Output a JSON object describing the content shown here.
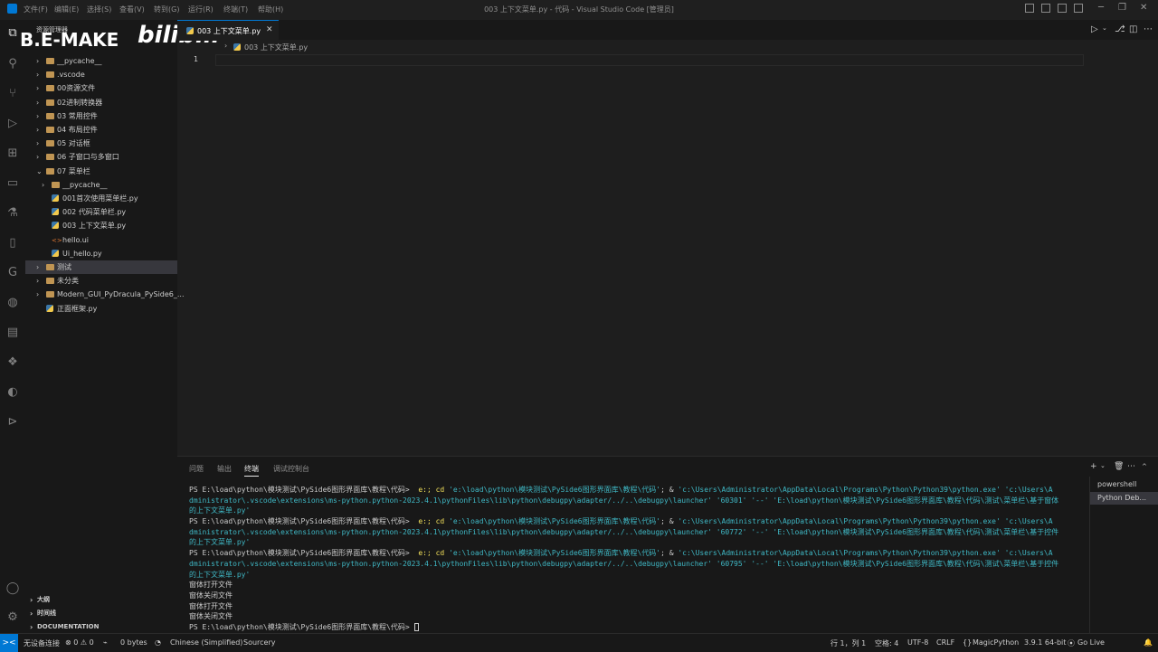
{
  "menu": [
    "文件(F)",
    "编辑(E)",
    "选择(S)",
    "查看(V)",
    "转到(G)",
    "运行(R)",
    "终端(T)",
    "帮助(H)"
  ],
  "window_title": "003 上下文菜单.py - 代码 - Visual Studio Code [管理员]",
  "brand": {
    "text": "B.E-MAKE",
    "bili": "bilibili"
  },
  "sidebar": {
    "title": "资源管理器",
    "items": [
      {
        "label": "__pycache__",
        "type": "folder",
        "indent": 0,
        "chev": ">"
      },
      {
        "label": ".vscode",
        "type": "folder",
        "indent": 0,
        "chev": ">"
      },
      {
        "label": "00资源文件",
        "type": "folder",
        "indent": 0,
        "chev": ">"
      },
      {
        "label": "02进制转换器",
        "type": "folder",
        "indent": 0,
        "chev": ">"
      },
      {
        "label": "03 常用控件",
        "type": "folder",
        "indent": 0,
        "chev": ">"
      },
      {
        "label": "04 布局控件",
        "type": "folder",
        "indent": 0,
        "chev": ">"
      },
      {
        "label": "05 对话框",
        "type": "folder",
        "indent": 0,
        "chev": ">"
      },
      {
        "label": "06 子窗口与多窗口",
        "type": "folder",
        "indent": 0,
        "chev": ">"
      },
      {
        "label": "07 菜单栏",
        "type": "folder",
        "indent": 0,
        "chev": "v"
      },
      {
        "label": "__pycache__",
        "type": "folder",
        "indent": 1,
        "chev": ">"
      },
      {
        "label": "001首次使用菜单栏.py",
        "type": "py",
        "indent": 1,
        "chev": ""
      },
      {
        "label": "002 代码菜单栏.py",
        "type": "py",
        "indent": 1,
        "chev": ""
      },
      {
        "label": "003 上下文菜单.py",
        "type": "py",
        "indent": 1,
        "chev": ""
      },
      {
        "label": "hello.ui",
        "type": "ui",
        "indent": 1,
        "chev": ""
      },
      {
        "label": "Ui_hello.py",
        "type": "py",
        "indent": 1,
        "chev": ""
      },
      {
        "label": "测试",
        "type": "folder",
        "indent": 0,
        "chev": ">",
        "selected": true
      },
      {
        "label": "未分类",
        "type": "folder",
        "indent": 0,
        "chev": ">"
      },
      {
        "label": "Modern_GUI_PyDracula_PySide6_...",
        "type": "folder",
        "indent": 0,
        "chev": ">"
      },
      {
        "label": "正面框架.py",
        "type": "py",
        "indent": 0,
        "chev": ""
      }
    ],
    "bottom_sections": [
      "大纲",
      "时间线",
      "DOCUMENTATION"
    ]
  },
  "editor": {
    "tab_label": "003 上下文菜单.py",
    "breadcrumb": "003 上下文菜单.py",
    "line_number": "1"
  },
  "panel": {
    "tabs": [
      "问题",
      "输出",
      "终端",
      "调试控制台"
    ],
    "active_tab": 2,
    "terminals": [
      "powershell",
      "Python Deb..."
    ],
    "lines": [
      [
        {
          "t": "PS E:\\load\\python\\模块测试\\PySide6图形界面库\\教程\\代码> ",
          "c": ""
        },
        {
          "t": " e:; cd ",
          "c": "cmd"
        },
        {
          "t": "'e:\\load\\python\\模块测试\\PySide6图形界面库\\教程\\代码'",
          "c": "str"
        },
        {
          "t": "; & ",
          "c": ""
        },
        {
          "t": "'c:\\Users\\Administrator\\AppData\\Local\\Programs\\Python\\Python39\\python.exe' 'c:\\Users\\A",
          "c": "str"
        }
      ],
      [
        {
          "t": "dministrator\\.vscode\\extensions\\ms-python.python-2023.4.1\\pythonFiles\\lib\\python\\debugpy\\adapter/../..\\debugpy\\launcher' '60301' '--' 'E:\\load\\python\\模块测试\\PySide6图形界面库\\教程\\代码\\测试\\菜单栏\\基于窗体",
          "c": "str"
        }
      ],
      [
        {
          "t": "的上下文菜单.py'",
          "c": "str"
        }
      ],
      [
        {
          "t": "PS E:\\load\\python\\模块测试\\PySide6图形界面库\\教程\\代码> ",
          "c": ""
        },
        {
          "t": " e:; cd ",
          "c": "cmd"
        },
        {
          "t": "'e:\\load\\python\\模块测试\\PySide6图形界面库\\教程\\代码'",
          "c": "str"
        },
        {
          "t": "; & ",
          "c": ""
        },
        {
          "t": "'c:\\Users\\Administrator\\AppData\\Local\\Programs\\Python\\Python39\\python.exe' 'c:\\Users\\A",
          "c": "str"
        }
      ],
      [
        {
          "t": "dministrator\\.vscode\\extensions\\ms-python.python-2023.4.1\\pythonFiles\\lib\\python\\debugpy\\adapter/../..\\debugpy\\launcher' '60772' '--' 'E:\\load\\python\\模块测试\\PySide6图形界面库\\教程\\代码\\测试\\菜单栏\\基于控件",
          "c": "str"
        }
      ],
      [
        {
          "t": "的上下文菜单.py'",
          "c": "str"
        }
      ],
      [
        {
          "t": "PS E:\\load\\python\\模块测试\\PySide6图形界面库\\教程\\代码> ",
          "c": ""
        },
        {
          "t": " e:; cd ",
          "c": "cmd"
        },
        {
          "t": "'e:\\load\\python\\模块测试\\PySide6图形界面库\\教程\\代码'",
          "c": "str"
        },
        {
          "t": "; & ",
          "c": ""
        },
        {
          "t": "'c:\\Users\\Administrator\\AppData\\Local\\Programs\\Python\\Python39\\python.exe' 'c:\\Users\\A",
          "c": "str"
        }
      ],
      [
        {
          "t": "dministrator\\.vscode\\extensions\\ms-python.python-2023.4.1\\pythonFiles\\lib\\python\\debugpy\\adapter/../..\\debugpy\\launcher' '60795' '--' 'E:\\load\\python\\模块测试\\PySide6图形界面库\\教程\\代码\\测试\\菜单栏\\基于控件",
          "c": "str"
        }
      ],
      [
        {
          "t": "的上下文菜单.py'",
          "c": "str"
        }
      ],
      [
        {
          "t": "窗体打开文件",
          "c": ""
        }
      ],
      [
        {
          "t": "窗体关闭文件",
          "c": ""
        }
      ],
      [
        {
          "t": "窗体打开文件",
          "c": ""
        }
      ],
      [
        {
          "t": "窗体关闭文件",
          "c": ""
        }
      ],
      [
        {
          "t": "PS E:\\load\\python\\模块测试\\PySide6图形界面库\\教程\\代码> ",
          "c": ""
        }
      ]
    ]
  },
  "statusbar": {
    "remote": "><",
    "mode": "无设备连接",
    "problems": "⊗ 0 ⚠ 0",
    "bytes": "0 bytes",
    "language_pack": "Chinese (Simplified)",
    "sourcery": "Sourcery",
    "position": "行 1，列 1",
    "spaces": "空格: 4",
    "encoding": "UTF-8",
    "eol": "CRLF",
    "language": "MagicPython",
    "interpreter": "3.9.1 64-bit",
    "golive": "Go Live"
  },
  "colors": {
    "accent": "#0078d4",
    "folder": "#c09553",
    "string": "#3fb8c5",
    "command": "#f2e05a"
  },
  "icons": [
    "explorer-icon",
    "search-icon",
    "source-control-icon",
    "run-debug-icon",
    "extensions-icon",
    "remote-explorer-icon",
    "testing-icon",
    "notebook-icon",
    "gitlens-icon",
    "github-icon",
    "folder-icon",
    "docker-icon",
    "edge-icon",
    "terminal-icon",
    "account-icon",
    "settings-icon"
  ]
}
